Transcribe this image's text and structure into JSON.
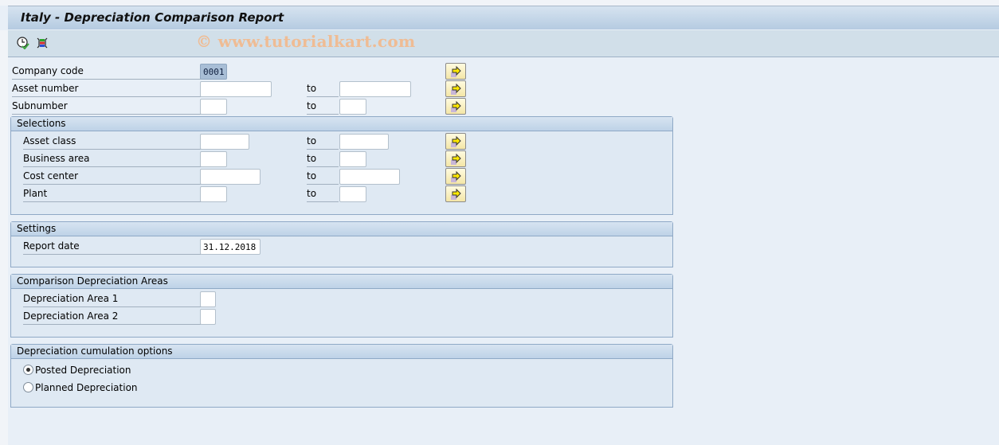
{
  "window": {
    "title": "Italy - Depreciation Comparison Report",
    "watermark": "© www.tutorialkart.com"
  },
  "toolbar": {
    "items": [
      {
        "icon": "execute-clock-icon",
        "tooltip": "Execute"
      },
      {
        "icon": "selection-options-icon",
        "tooltip": "Selection options"
      }
    ]
  },
  "top_fields": [
    {
      "label": "Company code",
      "from": "0001",
      "to_label": "",
      "to": null
    },
    {
      "label": "Asset number",
      "from": "",
      "to_label": "to",
      "to": ""
    },
    {
      "label": "Subnumber",
      "from": "",
      "to_label": "to",
      "to": ""
    }
  ],
  "selections": {
    "title": "Selections",
    "fields": [
      {
        "label": "Asset class",
        "from": "",
        "to_label": "to",
        "to": ""
      },
      {
        "label": "Business area",
        "from": "",
        "to_label": "to",
        "to": ""
      },
      {
        "label": "Cost center",
        "from": "",
        "to_label": "to",
        "to": ""
      },
      {
        "label": "Plant",
        "from": "",
        "to_label": "to",
        "to": ""
      }
    ]
  },
  "settings": {
    "title": "Settings",
    "report_date_label": "Report date",
    "report_date": "31.12.2018"
  },
  "comparison": {
    "title": "Comparison Depreciation Areas",
    "area1_label": "Depreciation Area 1",
    "area1_value": "",
    "area2_label": "Depreciation Area 2",
    "area2_value": ""
  },
  "cumulation": {
    "title": "Depreciation cumulation options",
    "options": [
      {
        "label": "Posted Depreciation",
        "selected": true
      },
      {
        "label": "Planned Depreciation",
        "selected": false
      }
    ]
  }
}
